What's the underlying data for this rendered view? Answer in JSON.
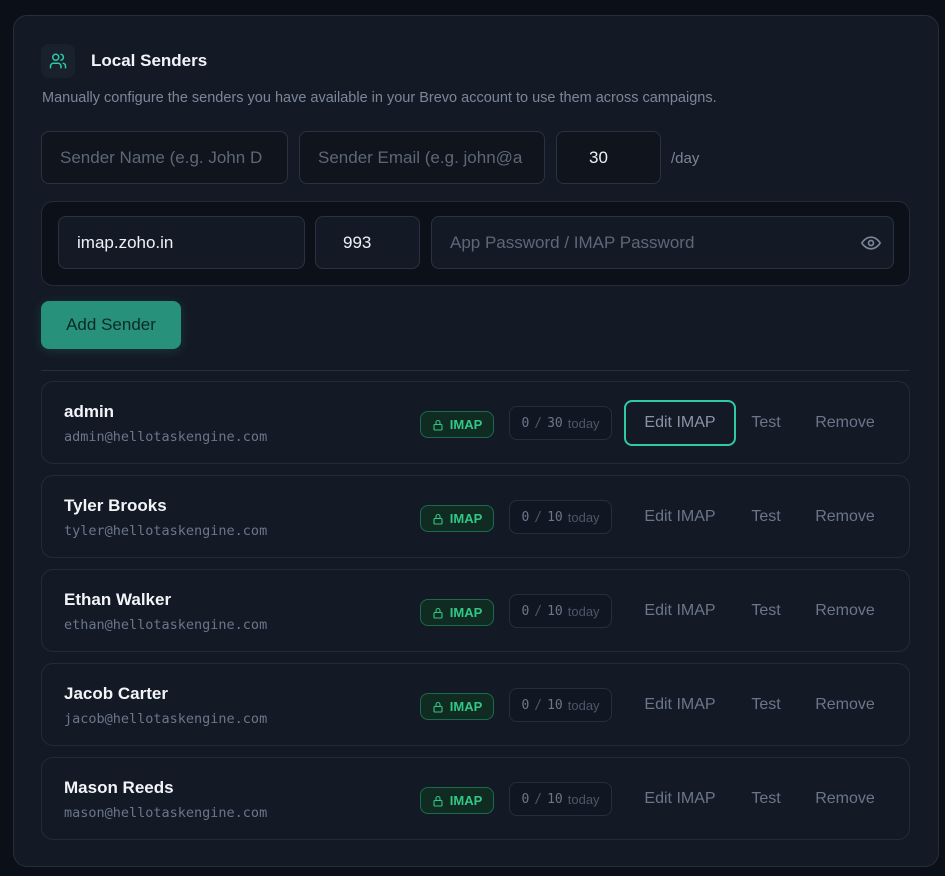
{
  "section": {
    "title": "Local Senders",
    "icon": "users-icon",
    "description": "Manually configure the senders you have available in your Brevo account to use them across campaigns."
  },
  "form": {
    "sender_name": {
      "value": "",
      "placeholder": "Sender Name (e.g. John D"
    },
    "sender_email": {
      "value": "",
      "placeholder": "Sender Email (e.g. john@a"
    },
    "daily_limit": {
      "value": "30"
    },
    "per_day_label": "/day",
    "imap_host": {
      "value": "imap.zoho.in"
    },
    "imap_port": {
      "value": "993"
    },
    "imap_password": {
      "value": "",
      "placeholder": "App Password / IMAP Password",
      "toggle_icon": "eye-icon"
    },
    "add_button": "Add Sender"
  },
  "senders": [
    {
      "name": "admin",
      "email": "admin@hellotaskengine.com",
      "badge": "IMAP",
      "sent": "0",
      "limit": "30",
      "today": "today",
      "edit": "Edit IMAP",
      "test": "Test",
      "remove": "Remove"
    },
    {
      "name": "Tyler Brooks",
      "email": "tyler@hellotaskengine.com",
      "badge": "IMAP",
      "sent": "0",
      "limit": "10",
      "today": "today",
      "edit": "Edit IMAP",
      "test": "Test",
      "remove": "Remove"
    },
    {
      "name": "Ethan Walker",
      "email": "ethan@hellotaskengine.com",
      "badge": "IMAP",
      "sent": "0",
      "limit": "10",
      "today": "today",
      "edit": "Edit IMAP",
      "test": "Test",
      "remove": "Remove"
    },
    {
      "name": "Jacob Carter",
      "email": "jacob@hellotaskengine.com",
      "badge": "IMAP",
      "sent": "0",
      "limit": "10",
      "today": "today",
      "edit": "Edit IMAP",
      "test": "Test",
      "remove": "Remove"
    },
    {
      "name": "Mason Reeds",
      "email": "mason@hellotaskengine.com",
      "badge": "IMAP",
      "sent": "0",
      "limit": "10",
      "today": "today",
      "edit": "Edit IMAP",
      "test": "Test",
      "remove": "Remove"
    }
  ],
  "colors": {
    "accent": "#27917c",
    "focus_ring": "#2fc9a8",
    "badge_text": "#33c785",
    "background": "#0b0f17",
    "card": "#141a25"
  }
}
